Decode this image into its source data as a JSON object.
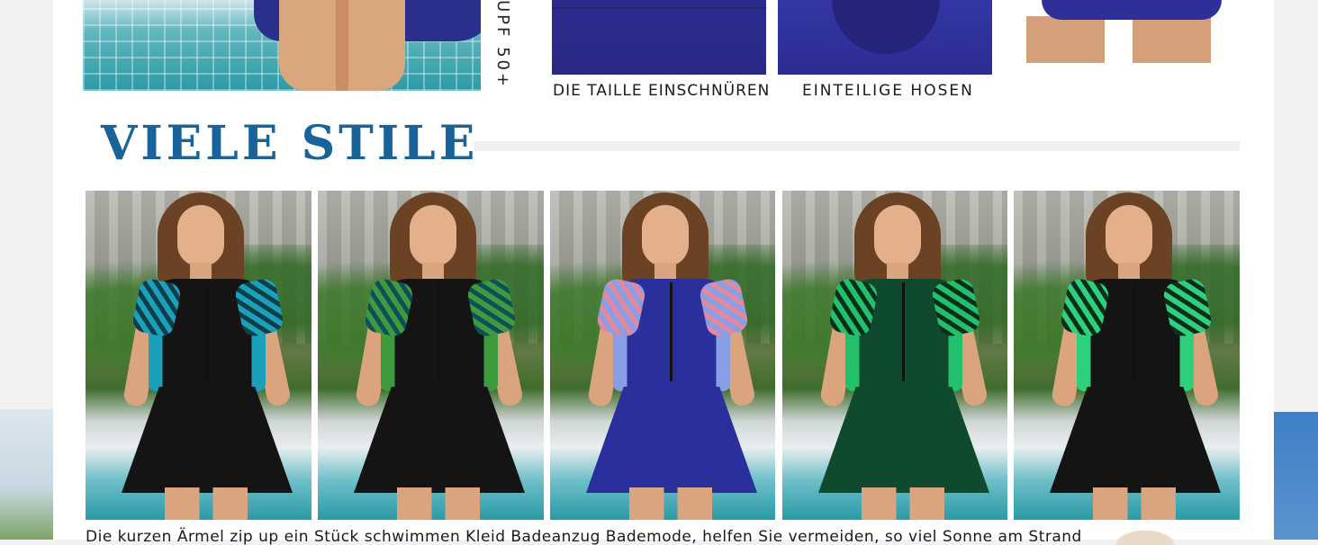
{
  "top_images": {
    "upf_label": "UPF 50+",
    "captions": [
      "DIE TAILLE EINSCHNÜREN",
      "EINTEILIGE HOSEN"
    ]
  },
  "section": {
    "title": "VIELE STILE"
  },
  "styles": [
    {
      "colors": {
        "body": "#141414",
        "print": "#1aa0b8",
        "print2": "#0f3d4a"
      }
    },
    {
      "colors": {
        "body": "#141414",
        "print": "#3d9b3e",
        "print2": "#0e4f5a"
      }
    },
    {
      "colors": {
        "body": "#2b2f9b",
        "print": "#8a9ee6",
        "print2": "#e7879a"
      }
    },
    {
      "colors": {
        "body": "#0f4a2e",
        "print": "#22c06a",
        "print2": "#0a2e1c"
      }
    },
    {
      "colors": {
        "body": "#141414",
        "print": "#2fd07c",
        "print2": "#0a2e1c"
      }
    }
  ],
  "description": "Die kurzen Ärmel zip up ein Stück schwimmen Kleid Badeanzug Bademode, helfen Sie vermeiden, so viel Sonne am Strand"
}
